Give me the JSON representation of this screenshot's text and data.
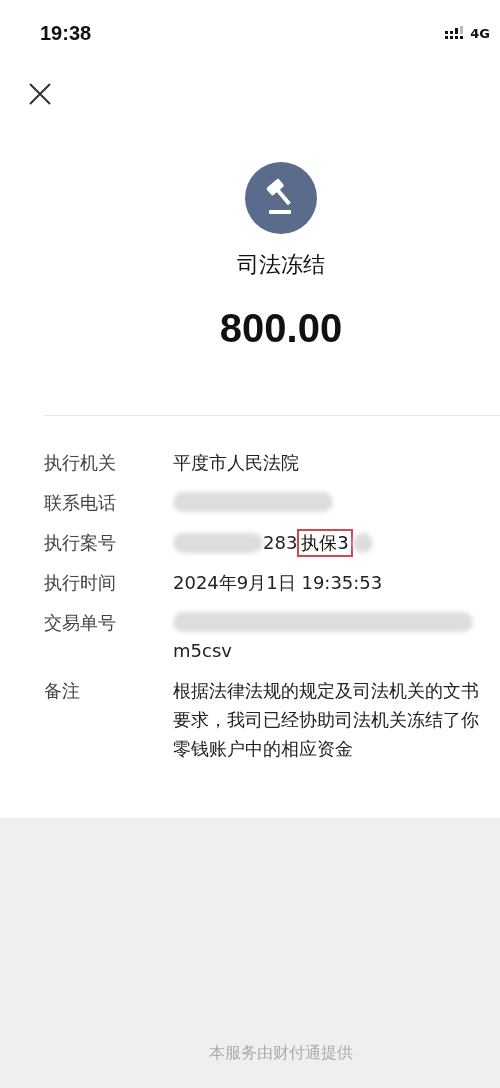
{
  "status_bar": {
    "time": "19:38",
    "network": "4G"
  },
  "header": {
    "title": "司法冻结",
    "amount": "800.00"
  },
  "details": [
    {
      "kind": "text",
      "label": "执行机关",
      "value": "平度市人民法院"
    },
    {
      "kind": "redacted",
      "label": "联系电话"
    },
    {
      "kind": "case",
      "label": "执行案号",
      "visible_text": "283",
      "highlighted_text": "执保3"
    },
    {
      "kind": "text",
      "label": "执行时间",
      "value": "2024年9月1日 19:35:53"
    },
    {
      "kind": "wrapped",
      "label": "交易单号",
      "value": "m5csv"
    },
    {
      "kind": "text",
      "label": "备注",
      "value": "根据法律法规的规定及司法机关的文书要求，我司已经协助司法机关冻结了你零钱账户中的相应资金"
    }
  ],
  "footer": "本服务由财付通提供"
}
